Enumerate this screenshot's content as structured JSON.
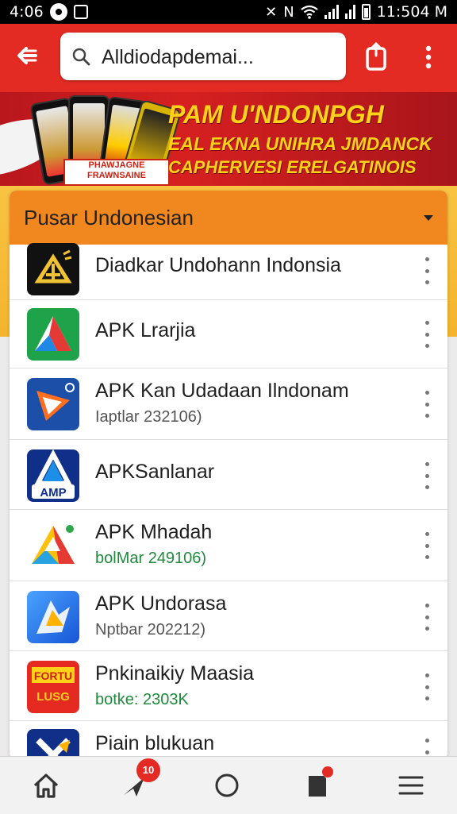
{
  "status_bar": {
    "time": "4:06",
    "right_time": "11:504 M",
    "icons": [
      "circle-icon",
      "screenshot-icon",
      "mute-icon",
      "nfc-icon",
      "wifi-icon",
      "signal-icon",
      "battery-icon"
    ]
  },
  "toolbar": {
    "url": "Alldiodapdemai...",
    "background_color": "#e32b24"
  },
  "banner": {
    "line1": "PAM U'NDONPGH",
    "line2": "EAL EKNA UNIHRA JMDANCK",
    "line3": "CAPHERVESI ERELGATINOIS",
    "tag_text": "PHAWJAGNE FRAWNSAINE"
  },
  "panel": {
    "title": "Pusar Undonesian",
    "header_color": "#f1871f"
  },
  "apps": [
    {
      "name": "Diadkar Undohann Indonsia",
      "sub": ""
    },
    {
      "name": "APK Lrarjia",
      "sub": ""
    },
    {
      "name": "APK Kan Udadaan Ilndonam",
      "sub": "Iaptlar 232106)"
    },
    {
      "name": "APKSanlanar",
      "sub": ""
    },
    {
      "name": "APK Mhadah",
      "sub": "bolMar 249106)"
    },
    {
      "name": "APK Undorasa",
      "sub": "Nptbar 202212)"
    },
    {
      "name": "Pnkinaikiy Maasia",
      "sub": "botke: 2303K"
    },
    {
      "name": "Piain blukuan",
      "sub": ""
    }
  ],
  "icon_texts": {
    "app4": "AMP",
    "app7_top": "FORTU",
    "app7_bottom": "LUSG"
  },
  "bottom_nav": {
    "badge_count": "10",
    "items": [
      "home-icon",
      "send-icon",
      "circle-icon",
      "bookmark-icon",
      "menu-icon"
    ]
  }
}
